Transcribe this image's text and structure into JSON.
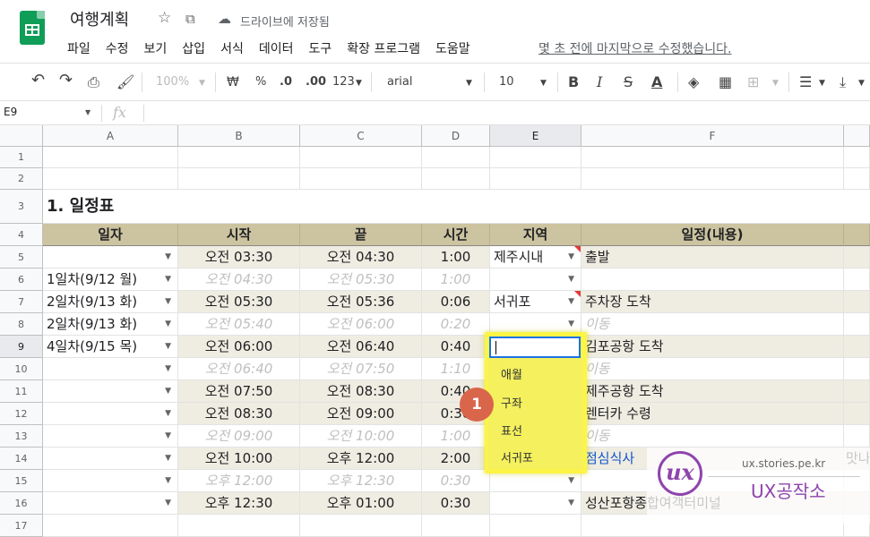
{
  "app": {
    "title": "여행계획",
    "save_status": "드라이브에 저장됨",
    "menu": [
      "파일",
      "수정",
      "보기",
      "삽입",
      "서식",
      "데이터",
      "도구",
      "확장 프로그램",
      "도움말"
    ],
    "last_edit": "몇 초 전에 마지막으로 수정했습니다."
  },
  "toolbar": {
    "zoom": "100%",
    "currency": "₩",
    "percent": "%",
    "dec_decrease": ".0",
    "dec_increase": ".00",
    "format_more": "123",
    "font": "arial",
    "font_size": "10",
    "bold": "B",
    "italic": "I",
    "strike": "S",
    "text_color": "A"
  },
  "formula_bar": {
    "name_box": "E9",
    "fx": "fx"
  },
  "columns": [
    "A",
    "B",
    "C",
    "D",
    "E",
    "F"
  ],
  "rows": [
    "1",
    "2",
    "3",
    "4",
    "5",
    "6",
    "7",
    "8",
    "9",
    "10",
    "11",
    "12",
    "13",
    "14",
    "15",
    "16",
    "17"
  ],
  "sheet": {
    "section_title": "1. 일정표",
    "headers": [
      "일자",
      "시작",
      "끝",
      "시간",
      "지역",
      "일정(내용)"
    ],
    "data_rows": [
      {
        "a": "",
        "b": "오전 03:30",
        "c": "오전 04:30",
        "d": "1:00",
        "e": "제주시내",
        "f": "출발"
      },
      {
        "a": "1일차(9/12 월)",
        "b": "오전 04:30",
        "c": "오전 05:30",
        "d": "1:00",
        "e": "",
        "f": ""
      },
      {
        "a": "2일차(9/13 화)",
        "b": "오전 05:30",
        "c": "오전 05:36",
        "d": "0:06",
        "e": "서귀포",
        "f": "주차장 도착"
      },
      {
        "a": "2일차(9/13 화)",
        "b": "오전 05:40",
        "c": "오전 06:00",
        "d": "0:20",
        "e": "",
        "f": "이동"
      },
      {
        "a": "4일차(9/15 목)",
        "b": "오전 06:00",
        "c": "오전 06:40",
        "d": "0:40",
        "e": "",
        "f": "김포공항 도착"
      },
      {
        "a": "",
        "b": "오전 06:40",
        "c": "오전 07:50",
        "d": "1:10",
        "e": "",
        "f": "이동"
      },
      {
        "a": "",
        "b": "오전 07:50",
        "c": "오전 08:30",
        "d": "0:40",
        "e": "",
        "f": "제주공항 도착"
      },
      {
        "a": "",
        "b": "오전 08:30",
        "c": "오전 09:00",
        "d": "0:30",
        "e": "",
        "f": "렌터카 수령"
      },
      {
        "a": "",
        "b": "오전 09:00",
        "c": "오전 10:00",
        "d": "1:00",
        "e": "",
        "f": "이동"
      },
      {
        "a": "",
        "b": "오전 10:00",
        "c": "오후 12:00",
        "d": "2:00",
        "e": "",
        "f": "점심식사"
      },
      {
        "a": "",
        "b": "오후 12:00",
        "c": "오후 12:30",
        "d": "0:30",
        "e": "",
        "f": ""
      },
      {
        "a": "",
        "b": "오후 12:30",
        "c": "오후 01:00",
        "d": "0:30",
        "e": "",
        "f": "성산포항종합여객터미널"
      }
    ],
    "overflow_text": "맛나"
  },
  "dropdown": {
    "options": [
      "애월",
      "구좌",
      "표선",
      "서귀포"
    ],
    "step_badge": "1"
  },
  "watermark": {
    "url": "ux.stories.pe.kr",
    "name": "UX공작소",
    "logo": "ux"
  }
}
